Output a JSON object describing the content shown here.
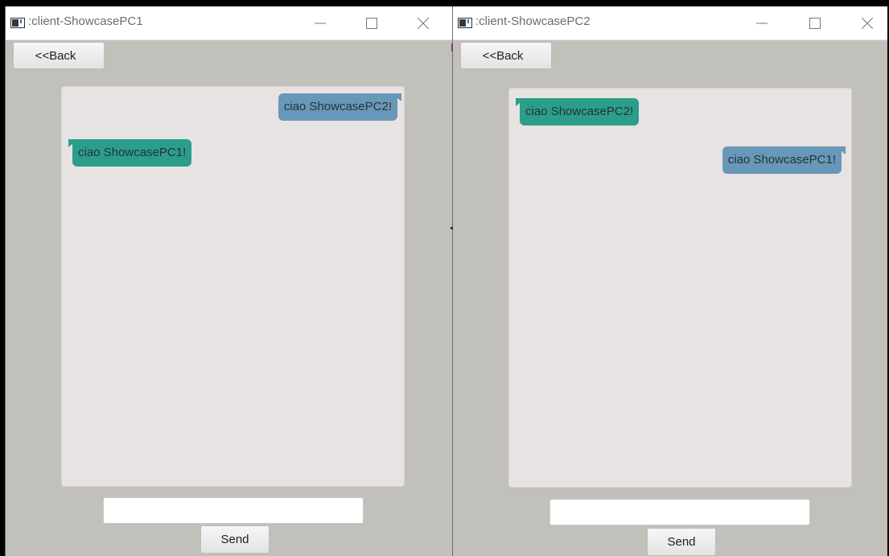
{
  "windows": [
    {
      "title": ":client-ShowcasePC1",
      "back_label": "<<Back",
      "messages": [
        {
          "text": "ciao ShowcasePC2!",
          "direction": "sent"
        },
        {
          "text": "ciao ShowcasePC1!",
          "direction": "received"
        }
      ],
      "input_value": "",
      "send_label": "Send"
    },
    {
      "title": ":client-ShowcasePC2",
      "back_label": "<<Back",
      "messages": [
        {
          "text": "ciao ShowcasePC2!",
          "direction": "received"
        },
        {
          "text": "ciao ShowcasePC1!",
          "direction": "sent"
        }
      ],
      "input_value": "",
      "send_label": "Send"
    }
  ],
  "icons": {
    "app": "java-window-icon",
    "minimize": "minimize-icon",
    "maximize": "maximize-icon",
    "close": "close-icon"
  },
  "colors": {
    "window_bg": "#c2c0bb",
    "chat_bg": "#e8e3e3",
    "sent_bubble": "#6898b9",
    "received_bubble": "#2a9e8a",
    "titlebar_bg": "#ffffff"
  }
}
